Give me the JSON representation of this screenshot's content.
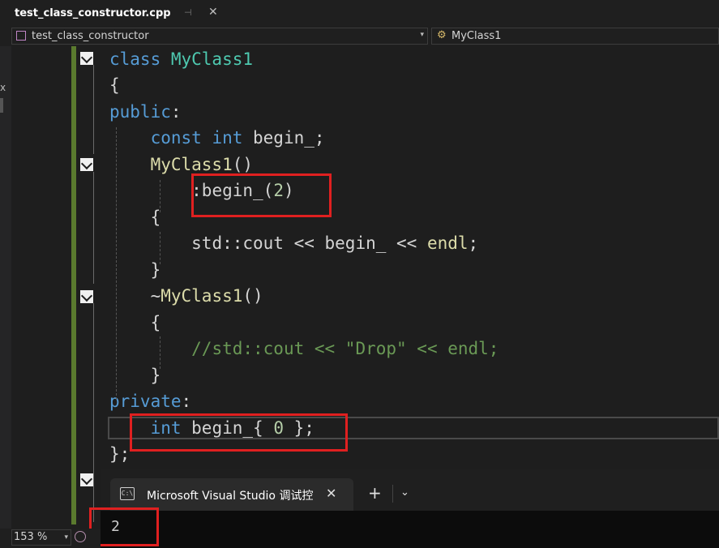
{
  "tab": {
    "title": "test_class_constructor.cpp",
    "pin_glyph": "⊣",
    "close_glyph": "✕"
  },
  "nav": {
    "project": "test_class_constructor",
    "member": "MyClass1"
  },
  "code_lines": [
    {
      "tokens": [
        {
          "t": "class ",
          "c": "kw"
        },
        {
          "t": "MyClass1",
          "c": "ty"
        }
      ]
    },
    {
      "tokens": [
        {
          "t": "{",
          "c": "br"
        }
      ]
    },
    {
      "tokens": [
        {
          "t": "public",
          "c": "kw"
        },
        {
          "t": ":",
          "c": "pl"
        }
      ]
    },
    {
      "tokens": [
        {
          "t": "    "
        },
        {
          "t": "const ",
          "c": "kw"
        },
        {
          "t": "int ",
          "c": "kw"
        },
        {
          "t": "begin_;",
          "c": "pl"
        }
      ]
    },
    {
      "tokens": [
        {
          "t": "    "
        },
        {
          "t": "MyClass1",
          "c": "fn"
        },
        {
          "t": "()",
          "c": "pl"
        }
      ]
    },
    {
      "tokens": [
        {
          "t": "        "
        },
        {
          "t": ":begin_(",
          "c": "pl"
        },
        {
          "t": "2",
          "c": "num"
        },
        {
          "t": ")",
          "c": "pl"
        }
      ]
    },
    {
      "tokens": [
        {
          "t": "    "
        },
        {
          "t": "{",
          "c": "br"
        }
      ]
    },
    {
      "tokens": [
        {
          "t": "        "
        },
        {
          "t": "std::cout << begin_ << ",
          "c": "pl"
        },
        {
          "t": "endl",
          "c": "fn"
        },
        {
          "t": ";",
          "c": "pl"
        }
      ]
    },
    {
      "tokens": [
        {
          "t": "    "
        },
        {
          "t": "}",
          "c": "br"
        }
      ]
    },
    {
      "tokens": [
        {
          "t": "    "
        },
        {
          "t": "~",
          "c": "pl"
        },
        {
          "t": "MyClass1",
          "c": "fn"
        },
        {
          "t": "()",
          "c": "pl"
        }
      ]
    },
    {
      "tokens": [
        {
          "t": "    "
        },
        {
          "t": "{",
          "c": "br"
        }
      ]
    },
    {
      "tokens": [
        {
          "t": "        "
        },
        {
          "t": "//std::cout << \"Drop\" << endl;",
          "c": "cm"
        }
      ]
    },
    {
      "tokens": [
        {
          "t": "    "
        },
        {
          "t": "}",
          "c": "br"
        }
      ]
    },
    {
      "tokens": [
        {
          "t": "private",
          "c": "kw"
        },
        {
          "t": ":",
          "c": "pl"
        }
      ]
    },
    {
      "tokens": [
        {
          "t": "    "
        },
        {
          "t": "int ",
          "c": "kw"
        },
        {
          "t": "begin_{ ",
          "c": "pl"
        },
        {
          "t": "0",
          "c": "num"
        },
        {
          "t": " };",
          "c": "pl"
        }
      ]
    },
    {
      "tokens": [
        {
          "t": "};",
          "c": "pl"
        }
      ]
    }
  ],
  "terminal": {
    "icon_text": "C:\\",
    "title": "Microsoft Visual Studio 调试控",
    "close_glyph": "✕",
    "new_tab_glyph": "+",
    "dropdown_glyph": "⌄",
    "output": "2"
  },
  "status": {
    "zoom": "153 %"
  },
  "colors": {
    "keyword": "#569cd6",
    "type": "#4ec9b0",
    "function": "#dcdcaa",
    "number": "#b5cea8",
    "comment": "#6a9955",
    "highlight": "#e02020"
  }
}
